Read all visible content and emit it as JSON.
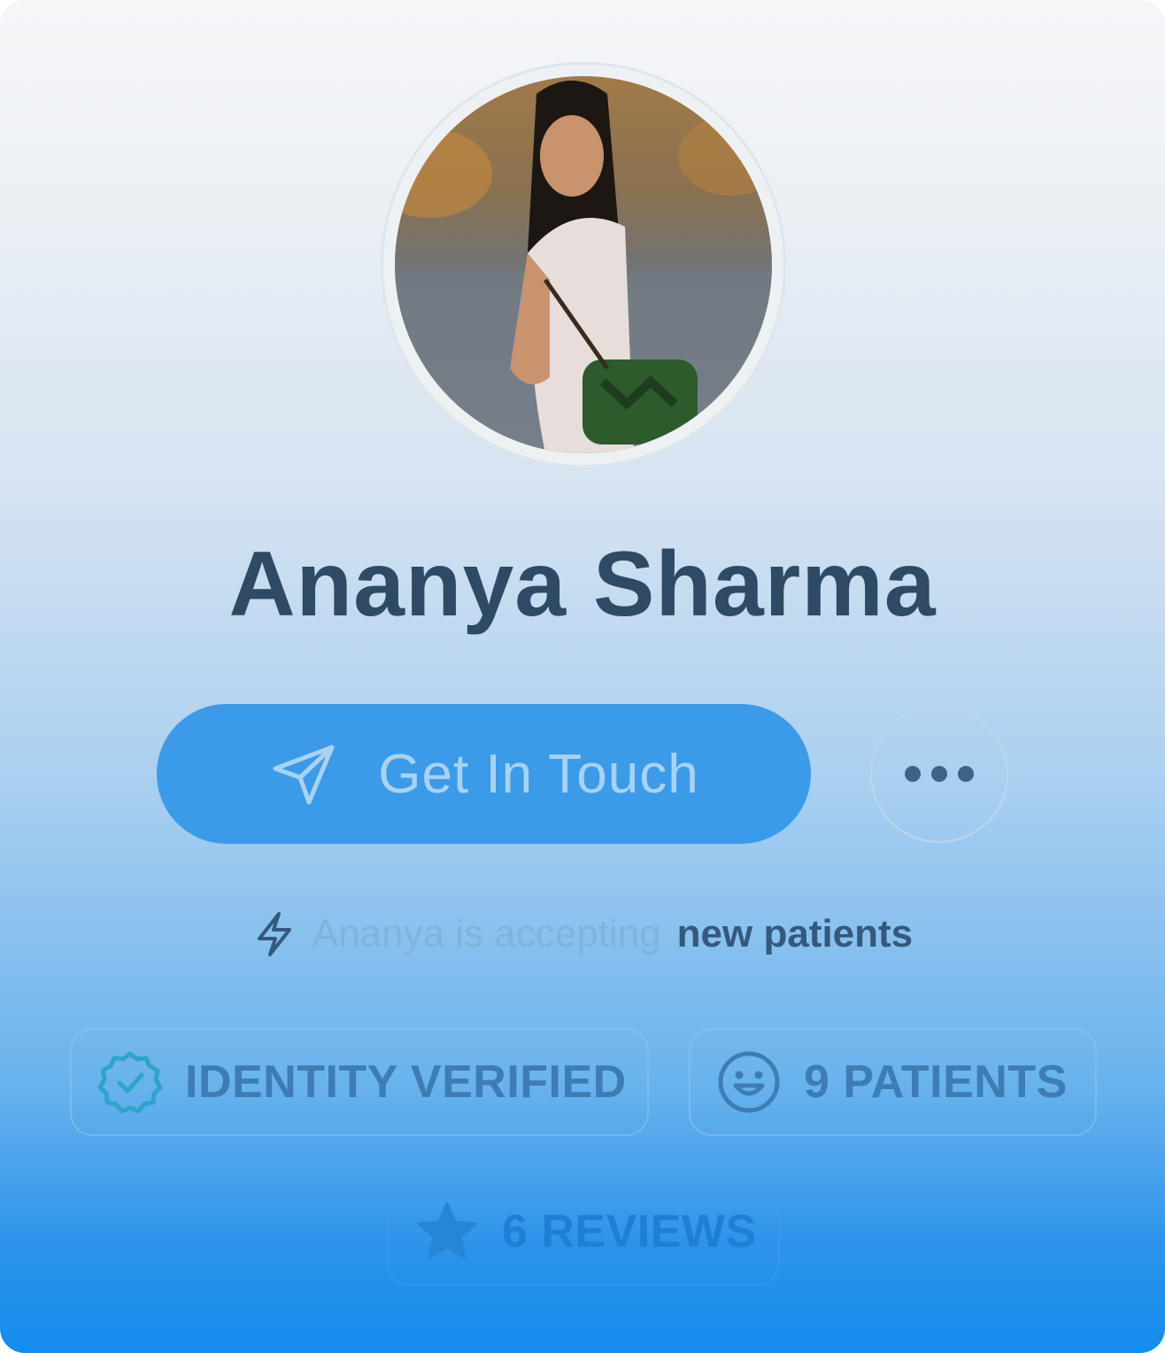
{
  "profile": {
    "name": "Ananya Sharma",
    "avatar_alt": "Profile photo"
  },
  "actions": {
    "primary_label": "Get In Touch",
    "primary_icon": "send-icon",
    "more_icon": "more-dots-icon"
  },
  "status": {
    "icon": "lightning-icon",
    "prefix": "Ananya is accepting",
    "highlight": "new patients"
  },
  "badges": [
    {
      "label": "IDENTITY VERIFIED",
      "icon": "verified-badge-icon",
      "color": "#2ea4c9"
    },
    {
      "label": "9 PATIENTS",
      "icon": "smile-icon",
      "color": "#3e7db4"
    },
    {
      "label": "6 REVIEWS",
      "icon": "star-icon",
      "color": "#1e7fd4"
    }
  ],
  "colors": {
    "heading": "#2f4a64",
    "cta_background": "#3c9be8",
    "cta_text": "#a8d2f3",
    "gradient_bottom": "#148cee"
  }
}
